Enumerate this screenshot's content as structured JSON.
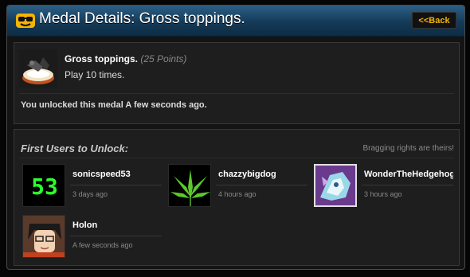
{
  "header": {
    "title": "Medal Details: Gross toppings.",
    "back_label": "<<Back"
  },
  "medal": {
    "name": "Gross toppings.",
    "points": "(25 Points)",
    "description": "Play 10 times.",
    "unlock_text": "You unlocked this medal A few seconds ago."
  },
  "first_users": {
    "heading": "First Users to Unlock:",
    "tagline": "Bragging rights are theirs!",
    "users": [
      {
        "name": "sonicspeed53",
        "time": "3 days ago"
      },
      {
        "name": "chazzybigdog",
        "time": "4 hours ago"
      },
      {
        "name": "WonderTheHedgehog",
        "time": "3 hours ago"
      },
      {
        "name": "Holon",
        "time": "A few seconds ago"
      }
    ]
  },
  "colors": {
    "title_bar": "#1e4a6d",
    "back_text": "#f4b400",
    "panel_bg": "#1e1e1e"
  }
}
